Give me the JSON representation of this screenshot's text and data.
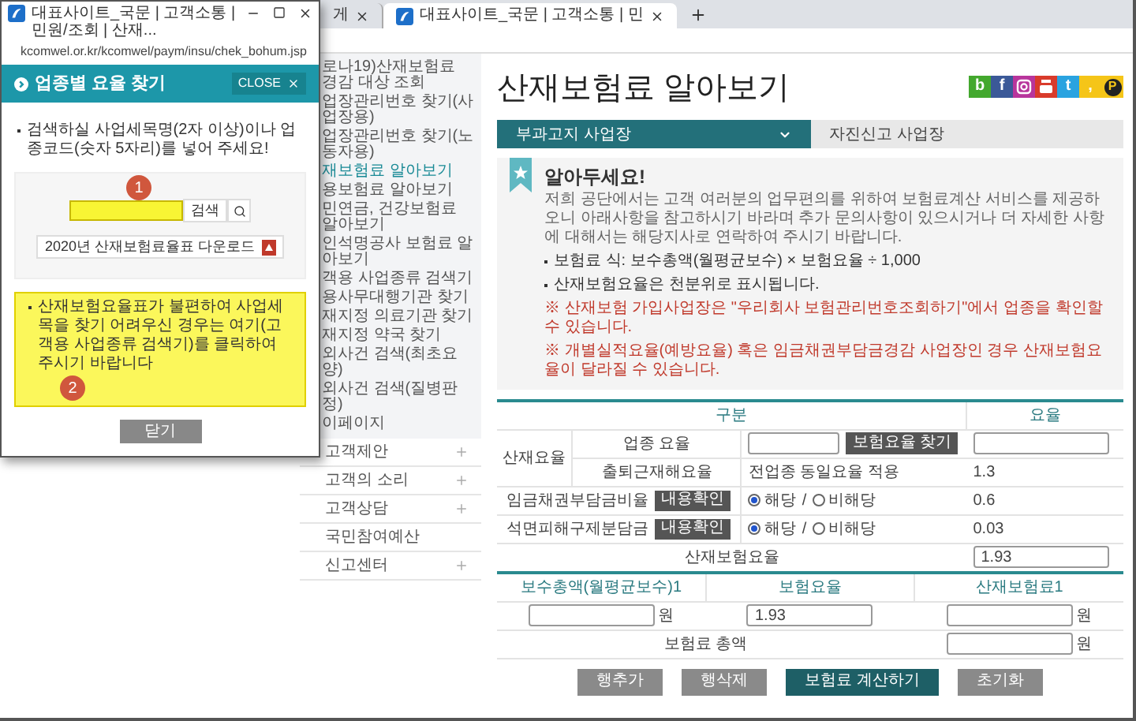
{
  "browser": {
    "tabs": [
      {
        "title": "게",
        "selected": false
      },
      {
        "title": "대표사이트_국문 | 고객소통 | 민",
        "selected": true
      }
    ]
  },
  "sidebar": {
    "submenu": [
      {
        "label": "로나19)산재보험료 경감 대상 조회",
        "selected": false
      },
      {
        "label": "업장관리번호 찾기(사업장용)",
        "selected": false
      },
      {
        "label": "업장관리번호 찾기(노동자용)",
        "selected": false
      },
      {
        "label": "재보험료 알아보기",
        "selected": true
      },
      {
        "label": "용보험료 알아보기",
        "selected": false
      },
      {
        "label": "민연금, 건강보험료 알아보기",
        "selected": false
      },
      {
        "label": "인석명공사 보험료 알아보기",
        "selected": false
      },
      {
        "label": "객용 사업종류 검색기",
        "selected": false
      },
      {
        "label": "용사무대행기관 찾기",
        "selected": false
      },
      {
        "label": "재지정 의료기관 찾기",
        "selected": false
      },
      {
        "label": "재지정 약국 찾기",
        "selected": false
      },
      {
        "label": "외사건 검색(최초요양)",
        "selected": false
      },
      {
        "label": "외사건 검색(질병판정)",
        "selected": false
      },
      {
        "label": "이페이지",
        "selected": false
      }
    ],
    "menu": [
      {
        "label": "고객제안",
        "expandable": true
      },
      {
        "label": "고객의 소리",
        "expandable": true
      },
      {
        "label": "고객상담",
        "expandable": true
      },
      {
        "label": "국민참여예산",
        "expandable": false
      },
      {
        "label": "신고센터",
        "expandable": true
      }
    ]
  },
  "main": {
    "title": "산재보험료 알아보기",
    "social": [
      {
        "kind": "letter",
        "label": "b",
        "color": "#43a82e"
      },
      {
        "kind": "letter",
        "label": "f",
        "color": "#3b5998"
      },
      {
        "kind": "instagram",
        "color": "#b8359c"
      },
      {
        "kind": "youtube",
        "color": "#d93b2b"
      },
      {
        "kind": "letter",
        "label": "t",
        "color": "#2aa3e0"
      },
      {
        "kind": "letter",
        "label": ",",
        "color": "#f5c518"
      },
      {
        "kind": "circle",
        "label": "P",
        "color": "#f5c518"
      }
    ],
    "tabs": [
      {
        "label": "부과고지 사업장",
        "selected": true
      },
      {
        "label": "자진신고 사업장",
        "selected": false
      }
    ],
    "notice": {
      "heading": "알아두세요!",
      "intro": "저희 공단에서는 고객 여러분의 업무편의를 위하여 보험료계산 서비스를 제공하오니 아래사항을 참고하시기 바라며 추가 문의사항이 있으시거나 더 자세한 사항에 대해서는 해당지사로 연락하여 주시기 바랍니다.",
      "bullets": [
        "보험료 식: 보수총액(월평균보수) × 보험요율 ÷ 1,000",
        "산재보험요율은 천분위로 표시됩니다."
      ],
      "warnings": [
        "※ 산재보험 가입사업장은 \"우리회사 보험관리번호조회하기\"에서 업종을 확인할 수 있습니다.",
        "※ 개별실적요율(예방요율) 혹은 임금채권부담금경감 사업장인 경우 산재보험요율이 달라질 수 있습니다."
      ]
    },
    "rate_table": {
      "columns": [
        "구분",
        "요율"
      ],
      "group_label": "산재요율",
      "rows": [
        {
          "kind": "input",
          "label": "업종 요율",
          "button": "보험요율 찾기"
        },
        {
          "kind": "fixed",
          "label": "출퇴근재해요율",
          "note": "전업종 동일요율 적용",
          "rate": "1.3"
        }
      ],
      "charges": [
        {
          "label": "임금채권부담금비율",
          "button": "내용확인",
          "options": [
            {
              "label": "해당",
              "selected": true
            },
            {
              "label": "비해당",
              "selected": false
            }
          ],
          "separator": "/",
          "rate": "0.6"
        },
        {
          "label": "석면피해구제분담금",
          "button": "내용확인",
          "options": [
            {
              "label": "해당",
              "selected": true
            },
            {
              "label": "비해당",
              "selected": false
            }
          ],
          "separator": "/",
          "rate": "0.03"
        }
      ],
      "total": {
        "label": "산재보험요율",
        "value": "1.93"
      }
    },
    "premium_table": {
      "columns": [
        "보수총액(월평균보수)1",
        "보험요율",
        "산재보험료1"
      ],
      "row": {
        "wage_unit": "원",
        "rate": "1.93",
        "premium_unit": "원"
      },
      "total": {
        "label": "보험료 총액",
        "unit": "원"
      }
    },
    "buttons": [
      {
        "label": "행추가",
        "kind": "secondary"
      },
      {
        "label": "행삭제",
        "kind": "secondary"
      },
      {
        "label": "보험료 계산하기",
        "kind": "primary"
      },
      {
        "label": "초기화",
        "kind": "secondary"
      }
    ]
  },
  "popup": {
    "title": "대표사이트_국문 | 고객소통 | 민원/조회 | 산재...",
    "url": "kcomwel.or.kr/kcomwel/paym/insu/chek_bohum.jsp",
    "header": "업종별 요율 찾기",
    "close": "CLOSE",
    "instruction": "검색하실 사업세목명(2자 이상)이나 업종코드(숫자 5자리)를 넣어 주세요!",
    "search_button": "검색",
    "download": "2020년 산재보험료율표 다운로드",
    "notice": "산재보험요율표가 불편하여 사업세목을 찾기 어려우신 경우는 여기(고객용 사업종류 검색기)를 클릭하여 주시기 바랍니다",
    "dismiss": "닫기",
    "markers": [
      "1",
      "2"
    ]
  }
}
